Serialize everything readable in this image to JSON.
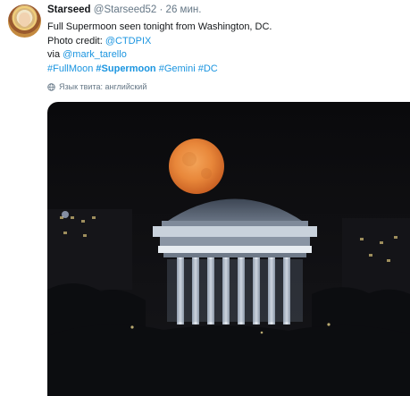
{
  "tweet": {
    "display_name": "Starseed",
    "handle": "@Starseed52",
    "separator": "·",
    "timestamp": "26 мин.",
    "text_line1": "Full Supermoon seen tonight from Washington, DC.",
    "text_line2_prefix": "Photo credit: ",
    "credit_link": "@CTDPIX",
    "text_line3_prefix": "via ",
    "via_link": "@mark_tarello",
    "hashtags": [
      "#FullMoon",
      "#Supermoon",
      "#Gemini",
      "#DC"
    ],
    "language_note": "Язык твита: английский"
  },
  "colors": {
    "link": "#1b95e0",
    "muted": "#657786",
    "text": "#14171a",
    "moon": "#e8873a"
  },
  "icons": {
    "avatar": "avatar-image",
    "language": "globe-icon"
  }
}
